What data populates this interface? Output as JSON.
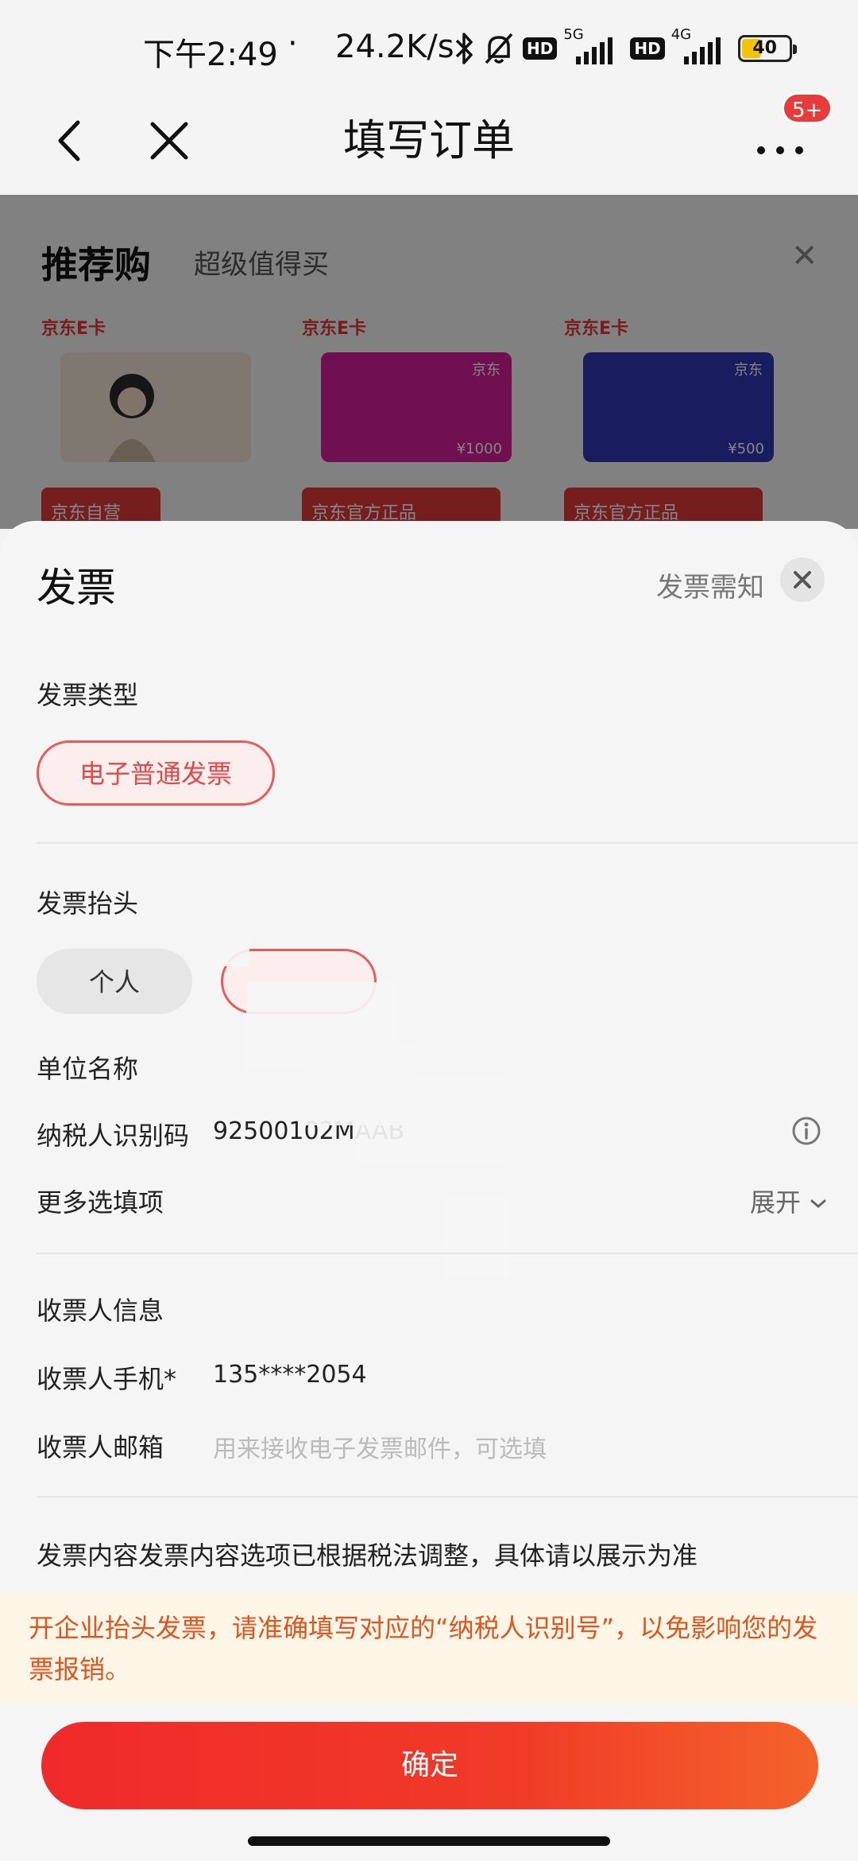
{
  "status_bar": {
    "time": "下午2:49",
    "dot": "·",
    "speed": "24.2K/s",
    "hd": "HD",
    "net1": "5G",
    "net2": "4G",
    "battery": "40",
    "icons": [
      "bluetooth-icon",
      "mute-bell-icon",
      "signal-icon",
      "battery-icon"
    ]
  },
  "nav": {
    "title": "填写订单",
    "badge": "5+"
  },
  "recommend": {
    "title": "推荐购",
    "subtitle": "超级值得买",
    "cards": [
      {
        "tag": "京东E卡",
        "value": ""
      },
      {
        "tag": "京东E卡",
        "brand": "京东",
        "value": "¥1000"
      },
      {
        "tag": "京东E卡",
        "brand": "京东",
        "value": "¥500"
      }
    ],
    "promos": [
      "京东自营",
      "京东官方正品",
      "京东官方正品"
    ]
  },
  "sheet": {
    "title": "发票",
    "notice_link": "发票需知",
    "invoice_type_label": "发票类型",
    "invoice_type_option": "电子普通发票",
    "header_label": "发票抬头",
    "header_option_personal": "个人",
    "company_name_label": "单位名称",
    "company_name_value": "",
    "tax_id_label": "纳税人识别码",
    "tax_id_value": "92500102MAAB",
    "more_options_label": "更多选填项",
    "expand_label": "展开",
    "receiver_section_label": "收票人信息",
    "receiver_phone_label": "收票人手机*",
    "receiver_phone_value": "135****2054",
    "receiver_email_label": "收票人邮箱",
    "receiver_email_placeholder": "用来接收电子发票邮件，可选填",
    "content_note": "发票内容发票内容选项已根据税法调整，具体请以展示为准",
    "warning": "开企业抬头发票，请准确填写对应的“纳税人识别号”，以免影响您的发票报销。",
    "confirm_label": "确定"
  },
  "colors": {
    "accent_red": "#e93b3b",
    "warning_text": "#e0541f",
    "warning_bg": "#fdf6e6"
  }
}
